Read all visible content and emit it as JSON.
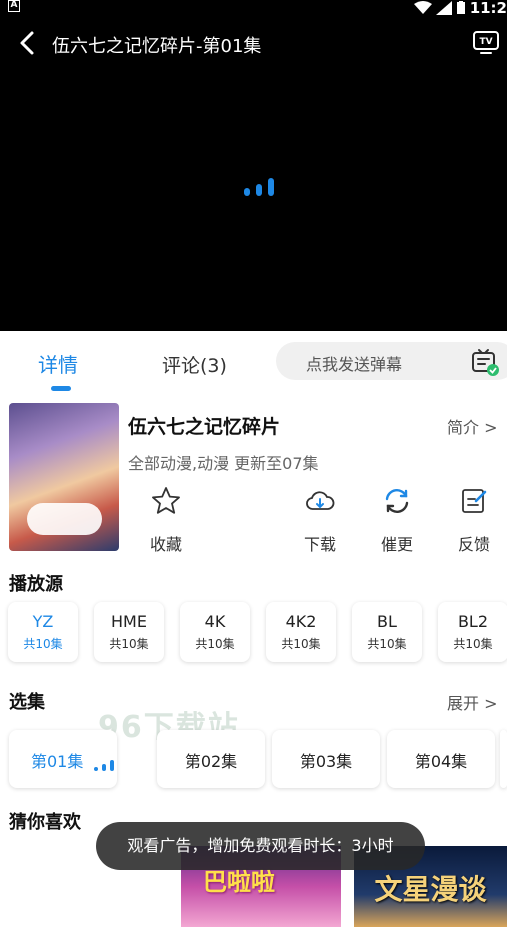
{
  "status_bar": {
    "badge": "A",
    "time": "11:2"
  },
  "header": {
    "title": "伍六七之记忆碎片-第01集"
  },
  "tabs": {
    "details": "详情",
    "comments": "评论(3)"
  },
  "danmaku": {
    "placeholder": "点我发送弹幕"
  },
  "anime": {
    "title": "伍六七之记忆碎片",
    "meta": "全部动漫,动漫 更新至07集",
    "intro_link": "简介 >"
  },
  "actions": {
    "favorite": "收藏",
    "download": "下载",
    "remind": "催更",
    "feedback": "反馈"
  },
  "sources": {
    "title": "播放源",
    "items": [
      {
        "name": "YZ",
        "count": "共10集"
      },
      {
        "name": "HME",
        "count": "共10集"
      },
      {
        "name": "4K",
        "count": "共10集"
      },
      {
        "name": "4K2",
        "count": "共10集"
      },
      {
        "name": "BL",
        "count": "共10集"
      },
      {
        "name": "BL2",
        "count": "共10集"
      }
    ]
  },
  "episodes": {
    "title": "选集",
    "expand": "展开 >",
    "items": [
      "第01集",
      "第02集",
      "第03集",
      "第04集"
    ]
  },
  "recommend": {
    "title": "猜你喜欢",
    "card2_text": "文星漫谈",
    "card1_text": "巴啦啦"
  },
  "watermark": "96下载站",
  "toast": "观看广告，增加免费观看时长：3小时",
  "colors": {
    "accent": "#1e88e5",
    "player_bg": "#000000"
  }
}
